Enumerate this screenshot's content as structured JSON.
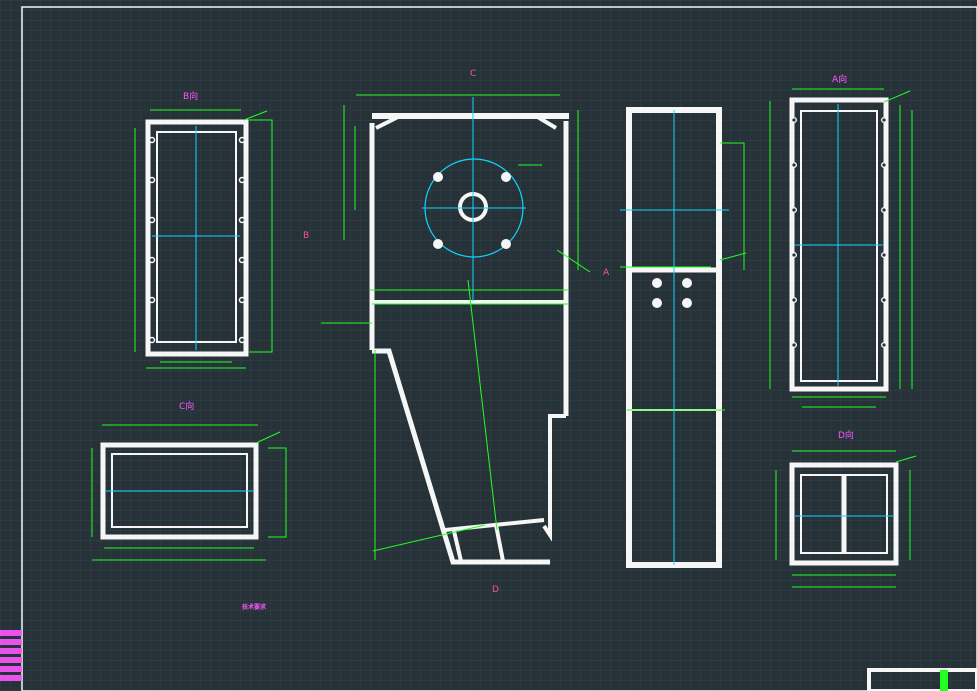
{
  "views": {
    "a": "A向",
    "b": "B向",
    "c": "C向",
    "d": "D向"
  },
  "marks": {
    "c": "C",
    "b": "B",
    "a": "A",
    "d": "D"
  },
  "notes": {
    "title": "技术要求"
  },
  "colors": {
    "background": "#263238",
    "grid": "#31434b",
    "part": "#f6f6f6",
    "dimension": "#22ff22",
    "center": "#11d6ff",
    "text": "#ff55ff"
  }
}
